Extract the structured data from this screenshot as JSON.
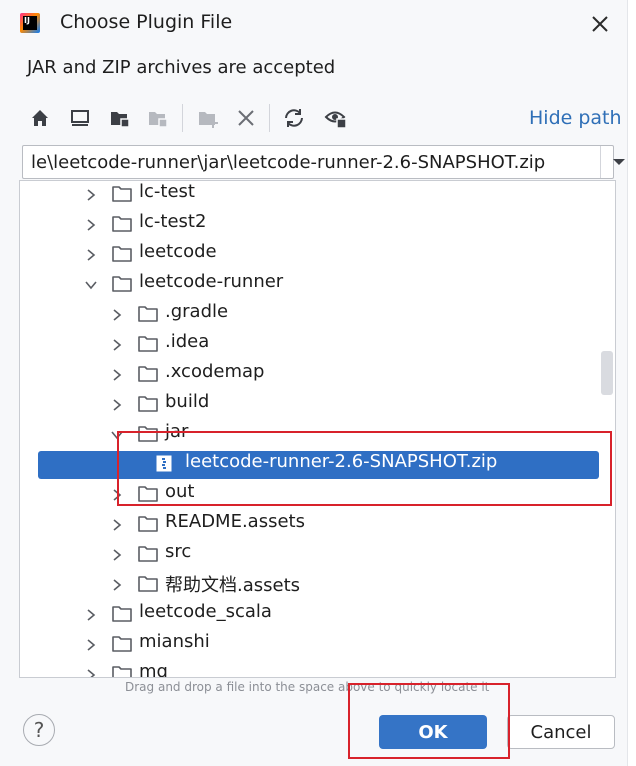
{
  "dialog": {
    "title": "Choose Plugin File",
    "description": "JAR and ZIP archives are accepted"
  },
  "toolbar": {
    "icons": [
      "home-icon",
      "desktop-icon",
      "project-folder-icon",
      "module-folder-icon",
      "new-folder-icon",
      "delete-icon",
      "refresh-icon",
      "show-hidden-icon"
    ],
    "hide_path_label": "Hide path"
  },
  "path": {
    "value": "le\\leetcode-runner\\jar\\leetcode-runner-2.6-SNAPSHOT.zip"
  },
  "tree": {
    "rows": [
      {
        "label": "lc-test",
        "depth": 0,
        "expanded": false,
        "type": "folder"
      },
      {
        "label": "lc-test2",
        "depth": 0,
        "expanded": false,
        "type": "folder"
      },
      {
        "label": "leetcode",
        "depth": 0,
        "expanded": false,
        "type": "folder"
      },
      {
        "label": "leetcode-runner",
        "depth": 0,
        "expanded": true,
        "type": "folder"
      },
      {
        "label": ".gradle",
        "depth": 1,
        "expanded": false,
        "type": "folder"
      },
      {
        "label": ".idea",
        "depth": 1,
        "expanded": false,
        "type": "folder"
      },
      {
        "label": ".xcodemap",
        "depth": 1,
        "expanded": false,
        "type": "folder"
      },
      {
        "label": "build",
        "depth": 1,
        "expanded": false,
        "type": "folder"
      },
      {
        "label": "jar",
        "depth": 1,
        "expanded": true,
        "type": "folder"
      },
      {
        "label": "leetcode-runner-2.6-SNAPSHOT.zip",
        "depth": 2,
        "type": "zip",
        "selected": true
      },
      {
        "label": "out",
        "depth": 1,
        "expanded": false,
        "type": "folder"
      },
      {
        "label": "README.assets",
        "depth": 1,
        "expanded": false,
        "type": "folder"
      },
      {
        "label": "src",
        "depth": 1,
        "expanded": false,
        "type": "folder"
      },
      {
        "label": "帮助文档.assets",
        "depth": 1,
        "expanded": false,
        "type": "folder"
      },
      {
        "label": "leetcode_scala",
        "depth": 0,
        "expanded": false,
        "type": "folder"
      },
      {
        "label": "mianshi",
        "depth": 0,
        "expanded": false,
        "type": "folder"
      },
      {
        "label": "mq",
        "depth": 0,
        "expanded": false,
        "type": "folder"
      }
    ]
  },
  "hint": "Drag and drop a file into the space above to quickly locate it",
  "buttons": {
    "help": "?",
    "ok": "OK",
    "cancel": "Cancel"
  },
  "colors": {
    "accent": "#3574c6",
    "selection": "#2f6fc4",
    "highlight_annotation": "#d8222b",
    "link": "#2f6fb7"
  }
}
